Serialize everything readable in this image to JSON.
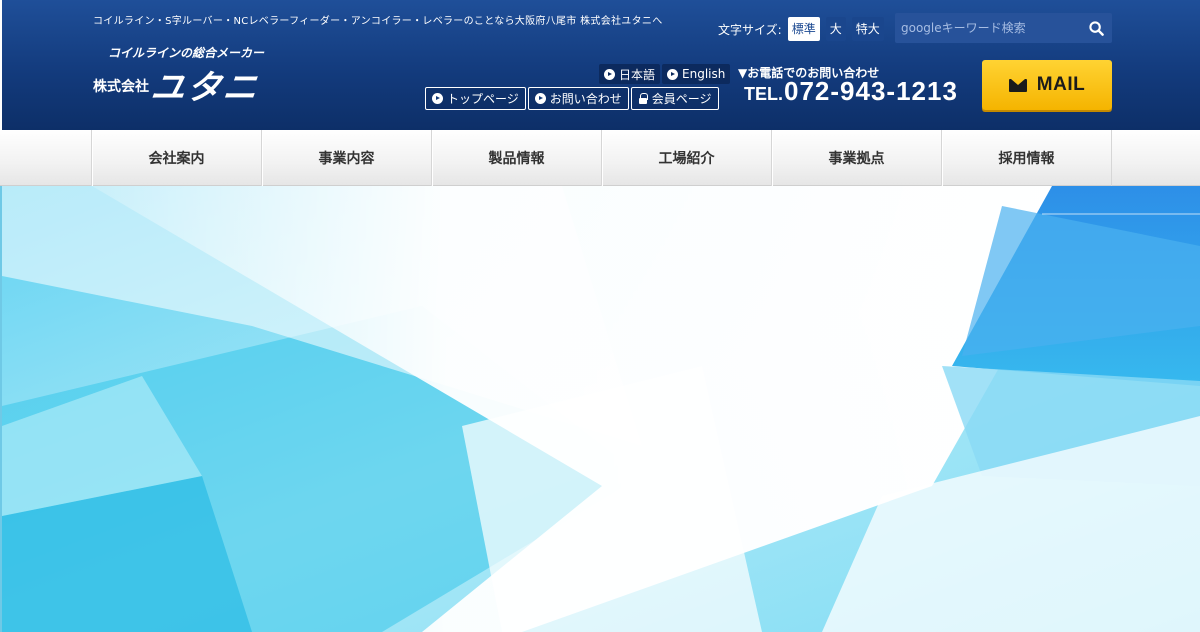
{
  "header": {
    "tagline": "コイルライン・S字ルーバー・NCレベラーフィーダー・アンコイラー・レベラーのことなら大阪府八尾市 株式会社ユタニへ",
    "logo_sub": "コイルラインの総合メーカー",
    "logo_prefix": "株式会社",
    "logo_name": "ユタニ"
  },
  "font_size": {
    "label": "文字サイズ:",
    "options": [
      "標準",
      "大",
      "特大"
    ],
    "selected": "標準"
  },
  "search": {
    "placeholder": "googleキーワード検索",
    "value": ""
  },
  "language": [
    "日本語",
    "English"
  ],
  "quick_links": [
    "トップページ",
    "お問い合わせ",
    "会員ページ"
  ],
  "contact": {
    "caption": "▼お電話でのお問い合わせ",
    "tel_prefix": "TEL.",
    "tel_number": "072-943-1213",
    "mail_label": "MAIL"
  },
  "nav": [
    "会社案内",
    "事業内容",
    "製品情報",
    "工場紹介",
    "事業拠点",
    "採用情報"
  ],
  "colors": {
    "header_bg": "#133b7d",
    "mail_button": "#f5b400",
    "hero_cyan": "#2fc6ea"
  }
}
